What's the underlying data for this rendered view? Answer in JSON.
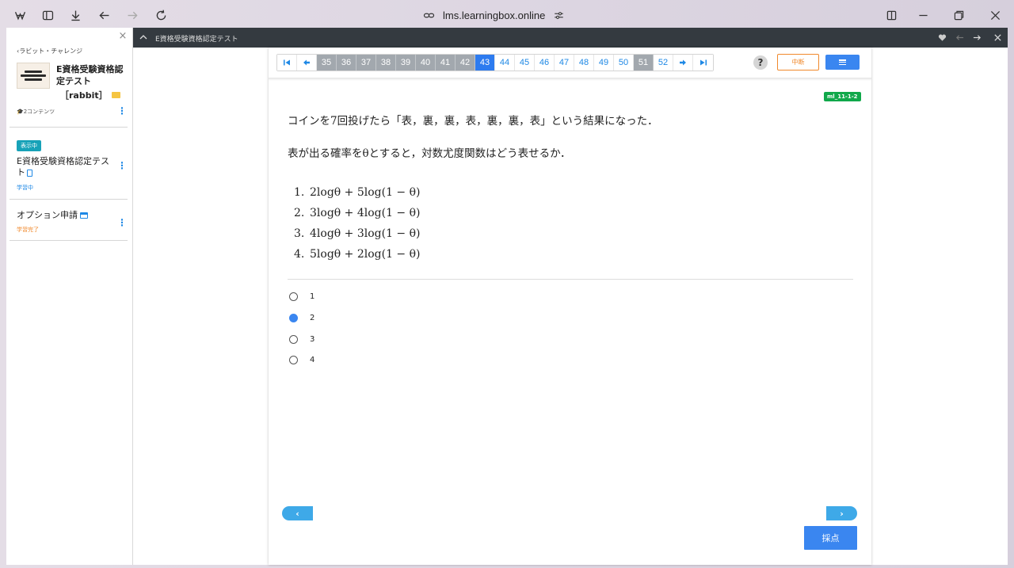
{
  "browser": {
    "url": "lms.learningbox.online"
  },
  "sidebar": {
    "back_label": "‹ラビット・チャレンジ",
    "course_title": "E資格受験資格認定テスト",
    "course_tag": "［rabbit］",
    "content_count": "🎓2コンテンツ",
    "items": [
      {
        "badge": "表示中",
        "title": "E資格受験資格認定テスト",
        "status": "学習中",
        "status_color": "#1e88e5"
      },
      {
        "title": "オプション申請",
        "status": "学習完了",
        "status_color": "#f0892c"
      }
    ]
  },
  "topbar": {
    "title": "E資格受験資格認定テスト"
  },
  "quiz": {
    "pages": [
      {
        "label": "35",
        "state": "done"
      },
      {
        "label": "36",
        "state": "done"
      },
      {
        "label": "37",
        "state": "done"
      },
      {
        "label": "38",
        "state": "done"
      },
      {
        "label": "39",
        "state": "done"
      },
      {
        "label": "40",
        "state": "done"
      },
      {
        "label": "41",
        "state": "done"
      },
      {
        "label": "42",
        "state": "done"
      },
      {
        "label": "43",
        "state": "current"
      },
      {
        "label": "44",
        "state": "todo"
      },
      {
        "label": "45",
        "state": "todo"
      },
      {
        "label": "46",
        "state": "todo"
      },
      {
        "label": "47",
        "state": "todo"
      },
      {
        "label": "48",
        "state": "todo"
      },
      {
        "label": "49",
        "state": "todo"
      },
      {
        "label": "50",
        "state": "todo"
      },
      {
        "label": "51",
        "state": "done"
      },
      {
        "label": "52",
        "state": "todo"
      }
    ],
    "help_label": "?",
    "pause_label": "中断",
    "question_id": "ml_11-1-2",
    "question_line1": "コインを7回投げたら「表，裏，裏，表，裏，裏，表」という結果になった．",
    "question_line2": "表が出る確率をθとすると，対数尤度関数はどう表せるか．",
    "options": [
      {
        "num": "1.",
        "text": "2logθ + 5log(1 − θ)"
      },
      {
        "num": "2.",
        "text": "3logθ + 4log(1 − θ)"
      },
      {
        "num": "3.",
        "text": "4logθ + 3log(1 − θ)"
      },
      {
        "num": "4.",
        "text": "5logθ + 2log(1 − θ)"
      }
    ],
    "answers": [
      {
        "label": "1",
        "checked": false
      },
      {
        "label": "2",
        "checked": true
      },
      {
        "label": "3",
        "checked": false
      },
      {
        "label": "4",
        "checked": false
      }
    ],
    "prev_label": "‹",
    "next_label": "›",
    "grade_label": "採点"
  }
}
